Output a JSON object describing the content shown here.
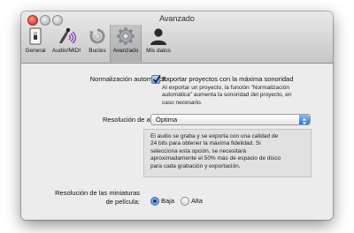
{
  "window": {
    "title": "Avanzado"
  },
  "toolbar": {
    "items": [
      {
        "label": "General",
        "icon": "switch-icon"
      },
      {
        "label": "Audio/MIDI",
        "icon": "audio-midi-icon"
      },
      {
        "label": "Bucles",
        "icon": "loops-icon"
      },
      {
        "label": "Avanzado",
        "icon": "gear-icon",
        "selected": true
      },
      {
        "label": "Mis datos",
        "icon": "person-icon"
      }
    ]
  },
  "normalization": {
    "label": "Normalización automática:",
    "checkbox_label": "Exportar proyectos con la máxima sonoridad",
    "checked": true,
    "description_lines": [
      "Al exportar un proyecto, la función \"Normalización",
      "automática\" aumenta la sonoridad del proyecto, en",
      "caso necesario."
    ]
  },
  "audio_resolution": {
    "label": "Resolución de audio:",
    "selected": "Óptima",
    "info_lines": [
      "El audio se graba y se exporta con una calidad de",
      "24 bits para obtener la máxima fidelidad. Si",
      "selecciona esta opción, se necesitará",
      "aproximadamente el 50% más de espacio de disco",
      "para cada grabación y exportación."
    ]
  },
  "thumbnails": {
    "label_line1": "Resolución de las miniaturas",
    "label_line2": "de película:",
    "options": [
      {
        "label": "Baja",
        "selected": true
      },
      {
        "label": "Alta",
        "selected": false
      }
    ]
  }
}
